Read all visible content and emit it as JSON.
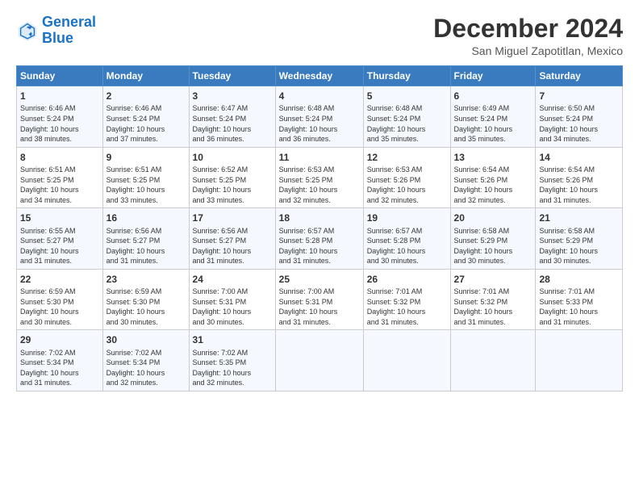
{
  "logo": {
    "line1": "General",
    "line2": "Blue"
  },
  "title": "December 2024",
  "subtitle": "San Miguel Zapotitlan, Mexico",
  "days_header": [
    "Sunday",
    "Monday",
    "Tuesday",
    "Wednesday",
    "Thursday",
    "Friday",
    "Saturday"
  ],
  "weeks": [
    [
      {
        "day": "1",
        "info": "Sunrise: 6:46 AM\nSunset: 5:24 PM\nDaylight: 10 hours\nand 38 minutes."
      },
      {
        "day": "2",
        "info": "Sunrise: 6:46 AM\nSunset: 5:24 PM\nDaylight: 10 hours\nand 37 minutes."
      },
      {
        "day": "3",
        "info": "Sunrise: 6:47 AM\nSunset: 5:24 PM\nDaylight: 10 hours\nand 36 minutes."
      },
      {
        "day": "4",
        "info": "Sunrise: 6:48 AM\nSunset: 5:24 PM\nDaylight: 10 hours\nand 36 minutes."
      },
      {
        "day": "5",
        "info": "Sunrise: 6:48 AM\nSunset: 5:24 PM\nDaylight: 10 hours\nand 35 minutes."
      },
      {
        "day": "6",
        "info": "Sunrise: 6:49 AM\nSunset: 5:24 PM\nDaylight: 10 hours\nand 35 minutes."
      },
      {
        "day": "7",
        "info": "Sunrise: 6:50 AM\nSunset: 5:24 PM\nDaylight: 10 hours\nand 34 minutes."
      }
    ],
    [
      {
        "day": "8",
        "info": "Sunrise: 6:51 AM\nSunset: 5:25 PM\nDaylight: 10 hours\nand 34 minutes."
      },
      {
        "day": "9",
        "info": "Sunrise: 6:51 AM\nSunset: 5:25 PM\nDaylight: 10 hours\nand 33 minutes."
      },
      {
        "day": "10",
        "info": "Sunrise: 6:52 AM\nSunset: 5:25 PM\nDaylight: 10 hours\nand 33 minutes."
      },
      {
        "day": "11",
        "info": "Sunrise: 6:53 AM\nSunset: 5:25 PM\nDaylight: 10 hours\nand 32 minutes."
      },
      {
        "day": "12",
        "info": "Sunrise: 6:53 AM\nSunset: 5:26 PM\nDaylight: 10 hours\nand 32 minutes."
      },
      {
        "day": "13",
        "info": "Sunrise: 6:54 AM\nSunset: 5:26 PM\nDaylight: 10 hours\nand 32 minutes."
      },
      {
        "day": "14",
        "info": "Sunrise: 6:54 AM\nSunset: 5:26 PM\nDaylight: 10 hours\nand 31 minutes."
      }
    ],
    [
      {
        "day": "15",
        "info": "Sunrise: 6:55 AM\nSunset: 5:27 PM\nDaylight: 10 hours\nand 31 minutes."
      },
      {
        "day": "16",
        "info": "Sunrise: 6:56 AM\nSunset: 5:27 PM\nDaylight: 10 hours\nand 31 minutes."
      },
      {
        "day": "17",
        "info": "Sunrise: 6:56 AM\nSunset: 5:27 PM\nDaylight: 10 hours\nand 31 minutes."
      },
      {
        "day": "18",
        "info": "Sunrise: 6:57 AM\nSunset: 5:28 PM\nDaylight: 10 hours\nand 31 minutes."
      },
      {
        "day": "19",
        "info": "Sunrise: 6:57 AM\nSunset: 5:28 PM\nDaylight: 10 hours\nand 30 minutes."
      },
      {
        "day": "20",
        "info": "Sunrise: 6:58 AM\nSunset: 5:29 PM\nDaylight: 10 hours\nand 30 minutes."
      },
      {
        "day": "21",
        "info": "Sunrise: 6:58 AM\nSunset: 5:29 PM\nDaylight: 10 hours\nand 30 minutes."
      }
    ],
    [
      {
        "day": "22",
        "info": "Sunrise: 6:59 AM\nSunset: 5:30 PM\nDaylight: 10 hours\nand 30 minutes."
      },
      {
        "day": "23",
        "info": "Sunrise: 6:59 AM\nSunset: 5:30 PM\nDaylight: 10 hours\nand 30 minutes."
      },
      {
        "day": "24",
        "info": "Sunrise: 7:00 AM\nSunset: 5:31 PM\nDaylight: 10 hours\nand 30 minutes."
      },
      {
        "day": "25",
        "info": "Sunrise: 7:00 AM\nSunset: 5:31 PM\nDaylight: 10 hours\nand 31 minutes."
      },
      {
        "day": "26",
        "info": "Sunrise: 7:01 AM\nSunset: 5:32 PM\nDaylight: 10 hours\nand 31 minutes."
      },
      {
        "day": "27",
        "info": "Sunrise: 7:01 AM\nSunset: 5:32 PM\nDaylight: 10 hours\nand 31 minutes."
      },
      {
        "day": "28",
        "info": "Sunrise: 7:01 AM\nSunset: 5:33 PM\nDaylight: 10 hours\nand 31 minutes."
      }
    ],
    [
      {
        "day": "29",
        "info": "Sunrise: 7:02 AM\nSunset: 5:34 PM\nDaylight: 10 hours\nand 31 minutes."
      },
      {
        "day": "30",
        "info": "Sunrise: 7:02 AM\nSunset: 5:34 PM\nDaylight: 10 hours\nand 32 minutes."
      },
      {
        "day": "31",
        "info": "Sunrise: 7:02 AM\nSunset: 5:35 PM\nDaylight: 10 hours\nand 32 minutes."
      },
      null,
      null,
      null,
      null
    ]
  ]
}
